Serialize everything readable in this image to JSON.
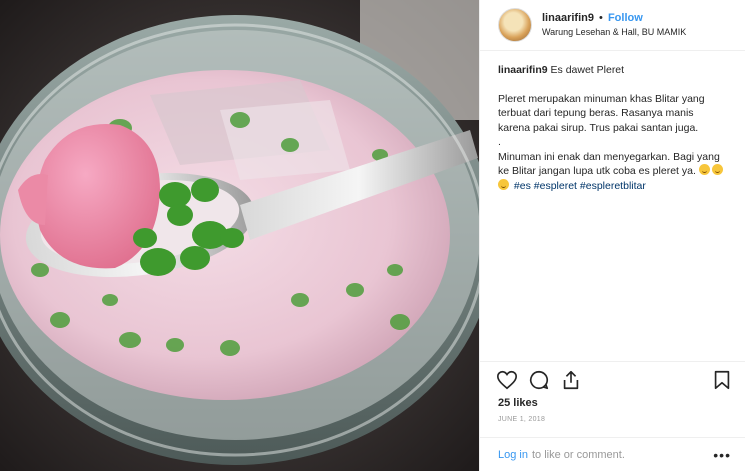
{
  "post": {
    "username": "linaarifin9",
    "follow_label": "Follow",
    "location": "Warung Lesehan & Hall, BU MAMIK",
    "caption_user": "linaarifin9",
    "caption_title": "Es dawet Pleret",
    "caption_p1": "Pleret merupakan minuman khas Blitar yang terbuat dari tepung beras. Rasanya manis karena pakai sirup. Trus pakai santan juga.",
    "caption_dot": ".",
    "caption_p2": "Minuman ini enak dan menyegarkan. Bagi yang ke Blitar jangan lupa utk coba es pleret ya.",
    "hashtags": [
      "#es",
      "#espleret",
      "#espleretblitar"
    ],
    "likes": "25 likes",
    "date": "JUNE 1, 2018",
    "login_label": "Log in",
    "login_suffix": "to like or comment.",
    "more_label": "•••"
  },
  "icons": [
    "heart-icon",
    "comment-icon",
    "share-icon",
    "bookmark-icon",
    "more-options-icon"
  ],
  "colors": {
    "link": "#3897f0",
    "hashtag": "#003569",
    "muted": "#999999",
    "text": "#262626"
  }
}
